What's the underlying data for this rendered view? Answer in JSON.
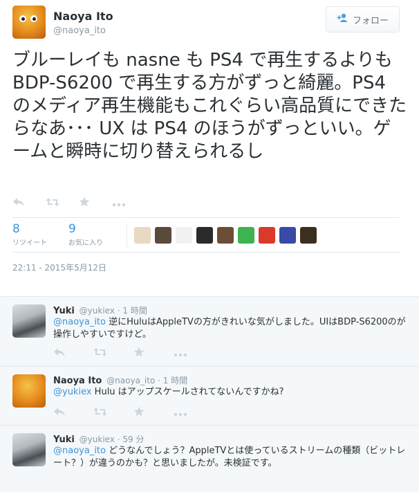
{
  "tweet": {
    "author_name": "Naoya Ito",
    "author_handle": "@naoya_ito",
    "follow_label": "フォロー",
    "text": "ブルーレイも nasne も PS4 で再生するよりも BDP-S6200 で再生する方がずっと綺麗。PS4 のメディア再生機能もこれぐらい高品質にできたらなあ･･･ UX は PS4 のほうがずっといい。ゲームと瞬時に切り替えられるし",
    "retweets_count": "8",
    "retweets_label": "リツイート",
    "favorites_count": "9",
    "favorites_label": "お気に入り",
    "timestamp": "22:11 - 2015年5月12日"
  },
  "icons": {
    "reply": "reply-icon",
    "retweet": "retweet-icon",
    "favorite": "star-icon",
    "more": "more-icon",
    "follow": "add-user-icon"
  },
  "favoriters": [
    {
      "color": "#e9d9c2"
    },
    {
      "color": "#5a4a3c"
    },
    {
      "color": "#f1f1f1"
    },
    {
      "color": "#2b2b2b"
    },
    {
      "color": "#6b4e35"
    },
    {
      "color": "#3fb34f"
    },
    {
      "color": "#d93a2b"
    },
    {
      "color": "#3a4aa5"
    },
    {
      "color": "#3b2f1e"
    }
  ],
  "replies": [
    {
      "name": "Yuki",
      "handle": "@yukiex",
      "time": "· 1 時間",
      "mention": "@naoya_ito",
      "text": " 逆にHuluはAppleTVの方がきれいな気がしました。UIはBDP-S6200のが操作しやすいですけど。"
    },
    {
      "name": "Naoya Ito",
      "handle": "@naoya_ito",
      "time": "· 1 時間",
      "mention": "@yukiex",
      "text": " Hulu はアップスケールされてないんですかね?"
    },
    {
      "name": "Yuki",
      "handle": "@yukiex",
      "time": "· 59 分",
      "mention": "@naoya_ito",
      "text": " どうなんでしょう？AppleTVとは使っているストリームの種類（ビットレート？）が違うのかも？と思いましたが。未検証です。"
    }
  ]
}
